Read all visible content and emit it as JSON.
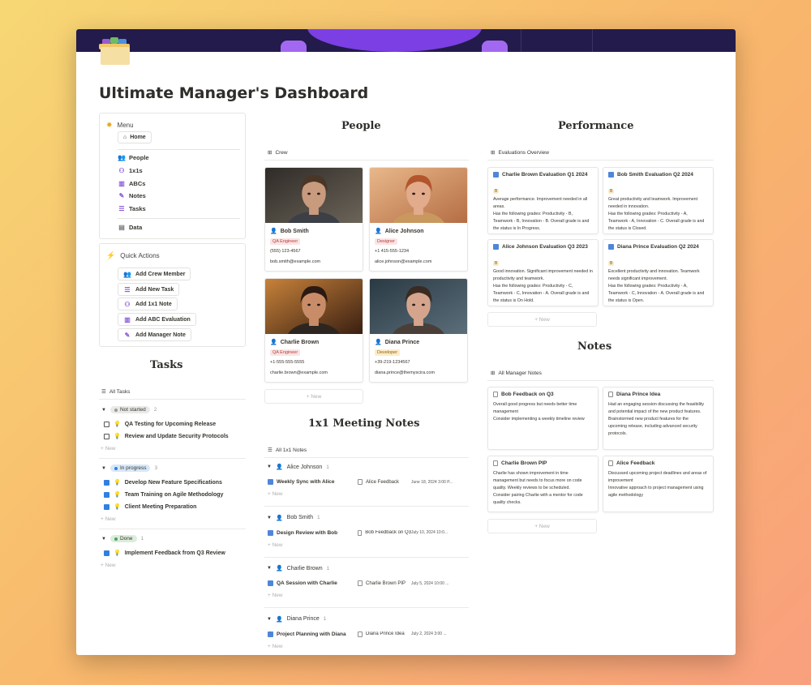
{
  "page": {
    "title": "Ultimate Manager's Dashboard"
  },
  "menu": {
    "heading": "Menu",
    "home": "Home",
    "items": [
      "People",
      "1x1s",
      "ABCs",
      "Notes",
      "Tasks"
    ],
    "data": "Data"
  },
  "quick_actions": {
    "heading": "Quick Actions",
    "buttons": [
      "Add Crew Member",
      "Add New Task",
      "Add 1x1 Note",
      "Add ABC Evaluation",
      "Add Manager Note"
    ]
  },
  "tasks": {
    "heading": "Tasks",
    "view": "All Tasks",
    "new_label": "New",
    "groups": [
      {
        "status": "Not started",
        "count": "2",
        "color": "#9b9a97",
        "bg": "#e9e9e7",
        "items": [
          {
            "label": "QA Testing for Upcoming Release",
            "done": false
          },
          {
            "label": "Review and Update Security Protocols",
            "done": false
          }
        ]
      },
      {
        "status": "In progress",
        "count": "3",
        "color": "#2f80e3",
        "bg": "#d7e8f8",
        "items": [
          {
            "label": "Develop New Feature Specifications",
            "done": true
          },
          {
            "label": "Team Training on Agile Methodology",
            "done": true
          },
          {
            "label": "Client Meeting Preparation",
            "done": true
          }
        ]
      },
      {
        "status": "Done",
        "count": "1",
        "color": "#4aa463",
        "bg": "#dbeddb",
        "items": [
          {
            "label": "Implement Feedback from Q3 Review",
            "done": true
          }
        ]
      }
    ]
  },
  "people": {
    "heading": "People",
    "view": "Crew",
    "new_label": "New",
    "cards": [
      {
        "name": "Bob Smith",
        "role": "QA Engineer",
        "role_bg": "#fbe4e4",
        "role_color": "#b4403c",
        "phone": "(555) 123-4567",
        "email": "bob.smith@example.com"
      },
      {
        "name": "Alice Johnson",
        "role": "Designer",
        "role_bg": "#fbe4e4",
        "role_color": "#b4403c",
        "phone": "+1 415-555-1234",
        "email": "alice.johnson@example.com"
      },
      {
        "name": "Charlie Brown",
        "role": "QA Engineer",
        "role_bg": "#fbe4e4",
        "role_color": "#b4403c",
        "phone": "+1-555-555-5555",
        "email": "charlie.brown@example.com"
      },
      {
        "name": "Diana Prince",
        "role": "Developer",
        "role_bg": "#fdecc8",
        "role_color": "#8a6314",
        "phone": "+39-219-1234567",
        "email": "diana.prince@themyscira.com"
      }
    ]
  },
  "meetings": {
    "heading": "1x1 Meeting Notes",
    "view": "All 1x1 Notes",
    "new_label": "New",
    "groups": [
      {
        "person": "Alice Johnson",
        "count": "1",
        "title": "Weekly Sync with Alice",
        "link": "Alice Feedback",
        "date": "June 18, 2024 3:00 P..."
      },
      {
        "person": "Bob Smith",
        "count": "1",
        "title": "Design Review with Bob",
        "link": "Bob Feedback on Q3",
        "date": "July 10, 2024 10:0..."
      },
      {
        "person": "Charlie Brown",
        "count": "1",
        "title": "QA Session with Charlie",
        "link": "Charlie Brown PIP",
        "date": "July 5, 2024 10:00 ..."
      },
      {
        "person": "Diana Prince",
        "count": "1",
        "title": "Project Planning with Diana",
        "link": "Diana Prince Idea",
        "date": "July 2, 2024 3:00 ..."
      }
    ]
  },
  "performance": {
    "heading": "Performance",
    "view": "Evaluations Overview",
    "new_label": "New",
    "cards": [
      {
        "title": "Charlie Brown Evaluation Q1 2024",
        "grade": "B",
        "lines": [
          "Average performance. Improvement needed in all areas.",
          "Has the following grades: Productivity - B, Teamwork - B, Innovation - B. Overall grade is and the status is In Progress."
        ]
      },
      {
        "title": "Bob Smith Evaluation Q2 2024",
        "grade": "B",
        "lines": [
          "Great productivity and teamwork. Improvement needed in innovation.",
          "Has the following grades: Productivity - A, Teamwork - A, Innovation - C. Overall grade is and the status is Closed."
        ]
      },
      {
        "title": "Alice Johnson Evaluation Q3 2023",
        "grade": "B",
        "lines": [
          "Good innovation. Significant improvement needed in productivity and teamwork.",
          "Has the following grades: Productivity - C, Teamwork - C, Innovation - A. Overall grade is and the status is On Hold."
        ]
      },
      {
        "title": "Diana Prince Evaluation Q2 2024",
        "grade": "B",
        "lines": [
          "Excellent productivity and innovation. Teamwork needs significant improvement.",
          "Has the following grades: Productivity - A, Teamwork - C, Innovation - A. Overall grade is and the status is Open."
        ]
      }
    ]
  },
  "notes": {
    "heading": "Notes",
    "view": "All Manager Notes",
    "new_label": "New",
    "cards": [
      {
        "title": "Bob Feedback on Q3",
        "lines": [
          "Overall good progress but needs better time management",
          "Consider implementing a weekly timeline review"
        ]
      },
      {
        "title": "Diana Prince Idea",
        "lines": [
          "Had an engaging session discussing the feasibility and potential impact of the new product features.",
          "Brainstormed new product features for the upcoming release, including advanced security protocols."
        ]
      },
      {
        "title": "Charlie Brown PIP",
        "lines": [
          "Charlie has shown improvement in time management but needs to focus more on code quality. Weekly reviews to be scheduled.",
          "Consider pairing Charlie with a mentor for code quality checks."
        ]
      },
      {
        "title": "Alice Feedback",
        "lines": [
          "Discussed upcoming project deadlines and areas of improvement",
          "Innovative approach to project management using agile methodology"
        ]
      }
    ]
  }
}
